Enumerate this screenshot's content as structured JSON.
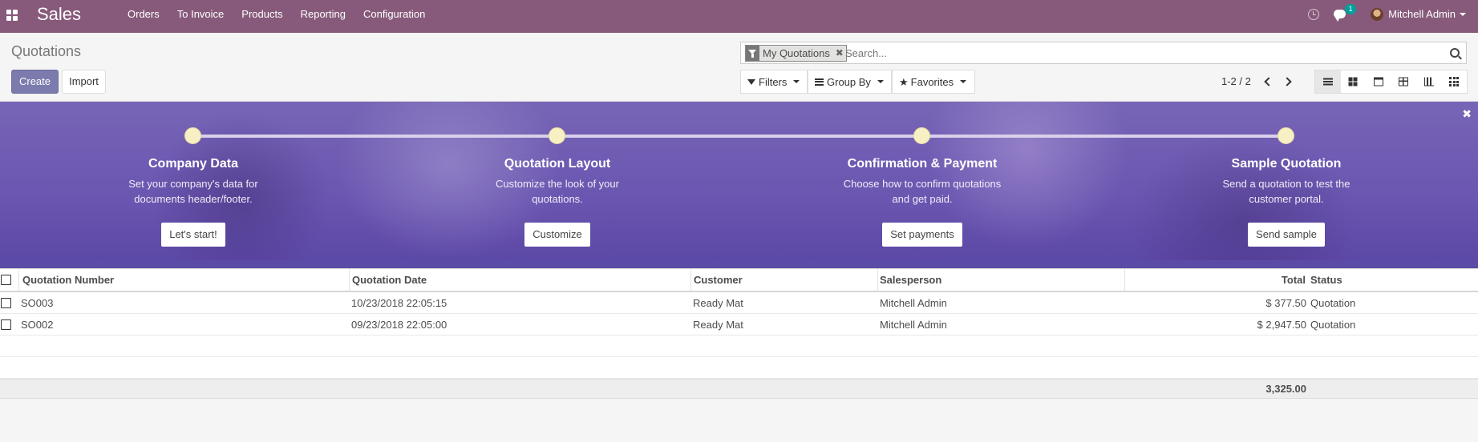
{
  "navbar": {
    "brand": "Sales",
    "menu": [
      "Orders",
      "To Invoice",
      "Products",
      "Reporting",
      "Configuration"
    ],
    "chat_badge": "1",
    "user": "Mitchell Admin"
  },
  "control_panel": {
    "breadcrumb": "Quotations",
    "create_label": "Create",
    "import_label": "Import",
    "search": {
      "facet": "My Quotations",
      "placeholder": "Search..."
    },
    "filters_label": "Filters",
    "group_by_label": "Group By",
    "favorites_label": "Favorites",
    "pager": "1-2 / 2"
  },
  "banner": {
    "steps": [
      {
        "title": "Company Data",
        "desc1": "Set your company's data for",
        "desc2": "documents header/footer.",
        "button": "Let's start!"
      },
      {
        "title": "Quotation Layout",
        "desc1": "Customize the look of your",
        "desc2": "quotations.",
        "button": "Customize"
      },
      {
        "title": "Confirmation & Payment",
        "desc1": "Choose how to confirm quotations",
        "desc2": "and get paid.",
        "button": "Set payments"
      },
      {
        "title": "Sample Quotation",
        "desc1": "Send a quotation to test the",
        "desc2": "customer portal.",
        "button": "Send sample"
      }
    ],
    "colors": {
      "dot": "#f7f0c4",
      "bg": "#6a55b0"
    }
  },
  "table": {
    "columns": [
      "Quotation Number",
      "Quotation Date",
      "Customer",
      "Salesperson",
      "Total",
      "Status"
    ],
    "rows": [
      {
        "number": "SO003",
        "date": "10/23/2018 22:05:15",
        "customer": "Ready Mat",
        "salesperson": "Mitchell Admin",
        "total": "$ 377.50",
        "status": "Quotation"
      },
      {
        "number": "SO002",
        "date": "09/23/2018 22:05:00",
        "customer": "Ready Mat",
        "salesperson": "Mitchell Admin",
        "total": "$ 2,947.50",
        "status": "Quotation"
      }
    ],
    "sum_total": "3,325.00"
  },
  "theme": {
    "primary": "#875a7b",
    "button": "#7c7bad"
  }
}
